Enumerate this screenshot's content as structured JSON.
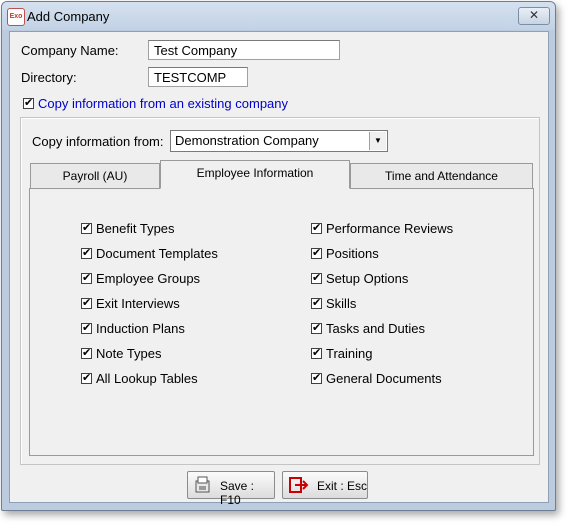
{
  "window": {
    "title": "Add Company",
    "app_icon_text": "Exo",
    "close_glyph": "✕"
  },
  "form": {
    "company_name_label": "Company Name:",
    "company_name_value": "Test Company",
    "directory_label": "Directory:",
    "directory_value": "TESTCOMP",
    "copy_existing_label": "Copy information from an existing company",
    "copy_existing_checked": true,
    "copy_from_label": "Copy information from:",
    "copy_from_value": "Demonstration Company"
  },
  "tabs": [
    {
      "label": "Payroll (AU)",
      "active": false
    },
    {
      "label": "Employee Information",
      "active": true
    },
    {
      "label": "Time and Attendance",
      "active": false
    }
  ],
  "left_items": [
    {
      "label": "Benefit Types",
      "checked": true
    },
    {
      "label": "Document Templates",
      "checked": true
    },
    {
      "label": "Employee Groups",
      "checked": true
    },
    {
      "label": "Exit Interviews",
      "checked": true
    },
    {
      "label": "Induction Plans",
      "checked": true
    },
    {
      "label": "Note Types",
      "checked": true
    },
    {
      "label": "All Lookup Tables",
      "checked": true
    }
  ],
  "right_items": [
    {
      "label": "Performance Reviews",
      "checked": true
    },
    {
      "label": "Positions",
      "checked": true
    },
    {
      "label": "Setup Options",
      "checked": true
    },
    {
      "label": "Skills",
      "checked": true
    },
    {
      "label": "Tasks and Duties",
      "checked": true
    },
    {
      "label": "Training",
      "checked": true
    },
    {
      "label": "General Documents",
      "checked": true
    }
  ],
  "buttons": {
    "save_label": "Save : F10",
    "exit_label": "Exit : Esc"
  },
  "colors": {
    "link_blue": "#0000cc",
    "exit_red": "#cc0000"
  }
}
